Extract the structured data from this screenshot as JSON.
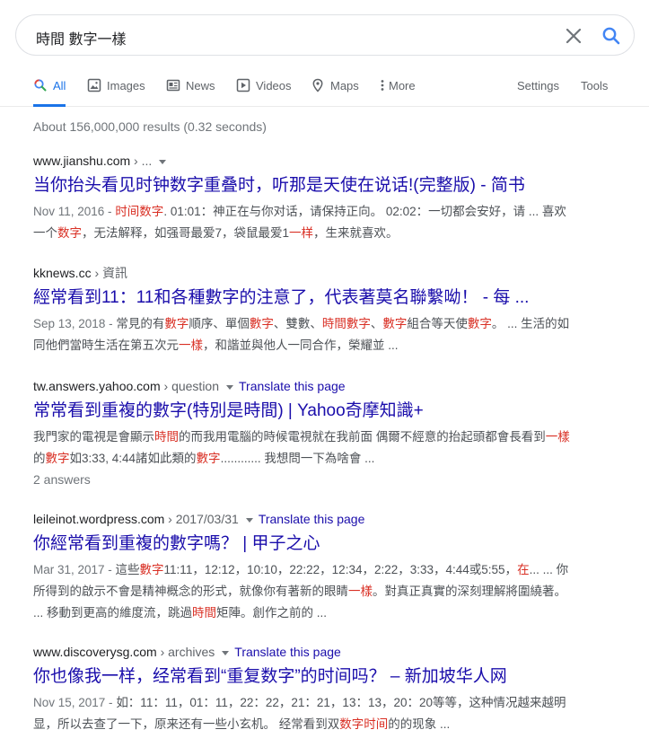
{
  "search": {
    "query": "時間 數字一樣"
  },
  "tabs": [
    {
      "label": "All",
      "icon": "search-icon"
    },
    {
      "label": "Images",
      "icon": "image-icon"
    },
    {
      "label": "News",
      "icon": "newspaper-icon"
    },
    {
      "label": "Videos",
      "icon": "play-icon"
    },
    {
      "label": "Maps",
      "icon": "map-pin-icon"
    },
    {
      "label": "More",
      "icon": "more-vert-icon"
    },
    {
      "label": "Settings"
    },
    {
      "label": "Tools"
    }
  ],
  "stats": "About 156,000,000 results (0.32 seconds)",
  "translate_label": "Translate this page",
  "results": [
    {
      "domain": "www.jianshu.com",
      "path": " › ...",
      "title": "当你抬头看见时钟数字重叠时，听那是天使在说话!(完整版) - 简书",
      "date": "Nov 11, 2016 - ",
      "snippet": [
        [
          "",
          ""
        ],
        [
          "时间数字",
          "em"
        ],
        [
          ". 01:01：神正在与你对话，请保持正向。 02:02：一切都会安好，请 ... 喜欢一个",
          ""
        ],
        [
          "数字",
          "em"
        ],
        [
          "，无法解释，如强哥最爱7，袋鼠最爱1",
          ""
        ],
        [
          "一样",
          "em"
        ],
        [
          "，生来就喜欢。",
          ""
        ]
      ]
    },
    {
      "domain": "kknews.cc",
      "path": " › 資訊",
      "title": "經常看到11：11和各種數字的注意了，代表著莫名聯繫呦！ - 每 ...",
      "date": "Sep 13, 2018 - ",
      "snippet": [
        [
          "常見的有",
          ""
        ],
        [
          "數字",
          "em"
        ],
        [
          "順序、單個",
          ""
        ],
        [
          "數字",
          "em"
        ],
        [
          "、雙數、",
          ""
        ],
        [
          "時間數字",
          "em"
        ],
        [
          "、",
          ""
        ],
        [
          "數字",
          "em"
        ],
        [
          "組合等天使",
          ""
        ],
        [
          "數字",
          "em"
        ],
        [
          "。 ... 生活的如同他們當時生活在第五次元",
          ""
        ],
        [
          "一樣",
          "em"
        ],
        [
          "，和諧並與他人一同合作，榮耀並 ...",
          ""
        ]
      ]
    },
    {
      "domain": "tw.answers.yahoo.com",
      "path": " › question",
      "title": "常常看到重複的數字(特別是時間) | Yahoo奇摩知識+",
      "date": "",
      "snippet": [
        [
          "我門家的電視是會顯示",
          ""
        ],
        [
          "時間",
          "em"
        ],
        [
          "的而我用電腦的時候電視就在我前面 偶爾不經意的抬起頭都會長看到",
          ""
        ],
        [
          "一樣",
          "em"
        ],
        [
          "的",
          ""
        ],
        [
          "數字",
          "em"
        ],
        [
          "如3:33, 4:44諸如此類的",
          ""
        ],
        [
          "數字",
          "em"
        ],
        [
          "............ 我想問一下為啥會 ...",
          ""
        ]
      ],
      "answers": "2 answers"
    },
    {
      "domain": "leileinot.wordpress.com",
      "path": " › 2017/03/31",
      "title": "你經常看到重複的數字嗎？ | 甲子之心",
      "date": "Mar 31, 2017 - ",
      "snippet": [
        [
          "這些",
          ""
        ],
        [
          "數字",
          "em"
        ],
        [
          "11:11，12:12，10:10，22:22，12:34，2:22，3:33，4:44或5:55，",
          ""
        ],
        [
          "在",
          "em"
        ],
        [
          "... ... 你所得到的啟示不會是精神概念的形式，就像你有著新的眼睛",
          ""
        ],
        [
          "一樣",
          "em"
        ],
        [
          "。對真正真實的深刻理解將圍繞著。 ... 移動到更高的維度流，跳過",
          ""
        ],
        [
          "時間",
          "em"
        ],
        [
          "矩陣。創作之前的 ...",
          ""
        ]
      ]
    },
    {
      "domain": "www.discoverysg.com",
      "path": " › archives",
      "title": "你也像我一样，经常看到“重复数字”的时间吗？ – 新加坡华人网",
      "date": "Nov 15, 2017 - ",
      "snippet": [
        [
          "如：11：11，01：11，22：22，21：21，13：13，20：20等等，这种情况越来越明显，所以去查了一下，原来还有一些小玄机。 经常看到双",
          ""
        ],
        [
          "数字时间",
          "em"
        ],
        [
          "的的现象 ...",
          ""
        ]
      ]
    }
  ]
}
